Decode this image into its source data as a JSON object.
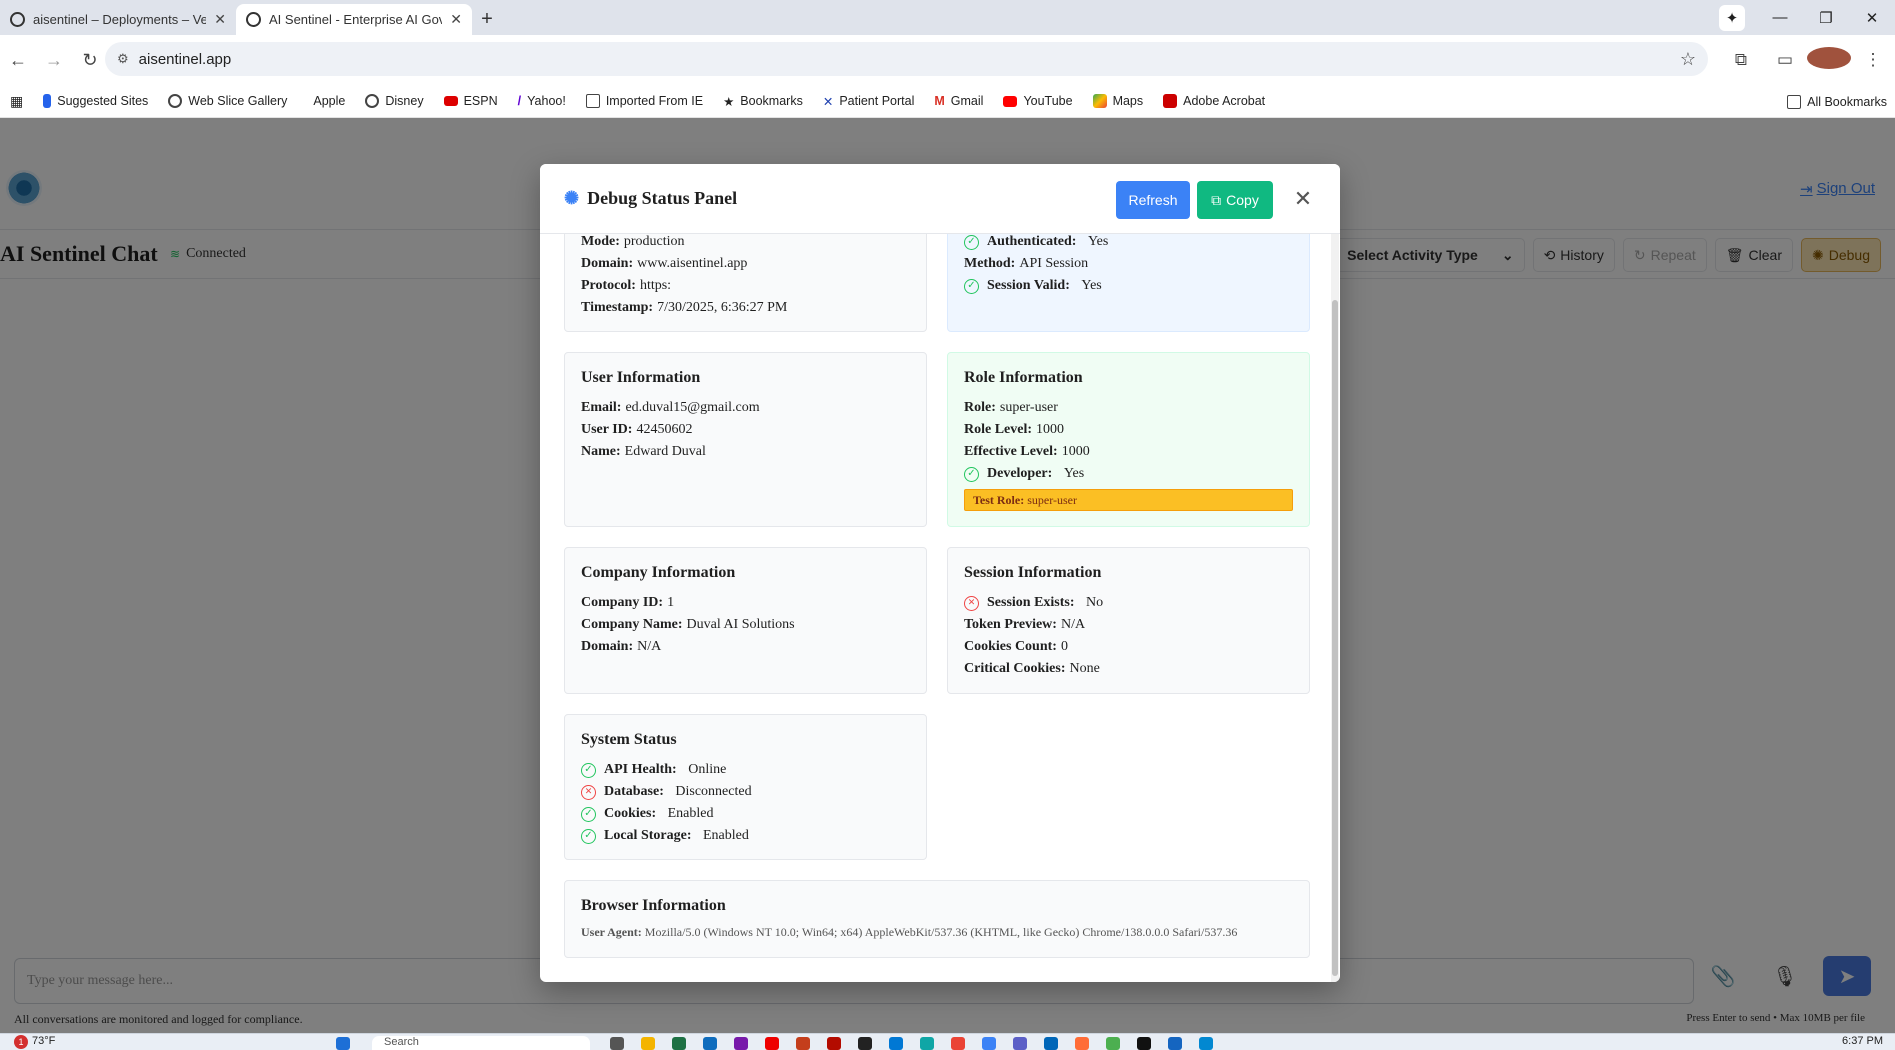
{
  "browser": {
    "tabs": [
      {
        "title": "aisentinel – Deployments – Vercel",
        "active": false
      },
      {
        "title": "AI Sentinel - Enterprise AI Governance",
        "active": true
      }
    ],
    "url": "aisentinel.app",
    "bookmarks": [
      "Suggested Sites",
      "Web Slice Gallery",
      "Apple",
      "Disney",
      "ESPN",
      "Yahoo!",
      "Imported From IE",
      "Bookmarks",
      "Patient Portal",
      "Gmail",
      "YouTube",
      "Maps",
      "Adobe Acrobat"
    ],
    "all_bookmarks": "All Bookmarks"
  },
  "app": {
    "sign_out": "Sign Out",
    "chat_title": "AI Sentinel Chat",
    "status": "Connected",
    "activity_select": "Select Activity Type",
    "buttons": {
      "history": "History",
      "repeat": "Repeat",
      "clear": "Clear",
      "debug": "Debug"
    },
    "input_placeholder": "Type your message here...",
    "footer_left": "All conversations are monitored and logged for compliance.",
    "footer_right": "Press Enter to send • Max 10MB per file"
  },
  "modal": {
    "title": "Debug Status Panel",
    "refresh": "Refresh",
    "copy": "Copy",
    "environment": {
      "mode_label": "Mode:",
      "mode": "production",
      "domain_label": "Domain:",
      "domain": "www.aisentinel.app",
      "protocol_label": "Protocol:",
      "protocol": "https:",
      "timestamp_label": "Timestamp:",
      "timestamp": "7/30/2025, 6:36:27 PM"
    },
    "auth": {
      "authenticated_label": "Authenticated:",
      "authenticated": "Yes",
      "method_label": "Method:",
      "method": "API Session",
      "session_valid_label": "Session Valid:",
      "session_valid": "Yes"
    },
    "user": {
      "heading": "User Information",
      "email_label": "Email:",
      "email": "ed.duval15@gmail.com",
      "user_id_label": "User ID:",
      "user_id": "42450602",
      "name_label": "Name:",
      "name": "Edward Duval"
    },
    "role": {
      "heading": "Role Information",
      "role_label": "Role:",
      "role": "super-user",
      "role_level_label": "Role Level:",
      "role_level": "1000",
      "effective_level_label": "Effective Level:",
      "effective_level": "1000",
      "developer_label": "Developer:",
      "developer": "Yes",
      "test_role_label": "Test Role:",
      "test_role": "super-user"
    },
    "company": {
      "heading": "Company Information",
      "company_id_label": "Company ID:",
      "company_id": "1",
      "company_name_label": "Company Name:",
      "company_name": "Duval AI Solutions",
      "domain_label": "Domain:",
      "domain": "N/A"
    },
    "session": {
      "heading": "Session Information",
      "session_exists_label": "Session Exists:",
      "session_exists": "No",
      "token_preview_label": "Token Preview:",
      "token_preview": "N/A",
      "cookies_count_label": "Cookies Count:",
      "cookies_count": "0",
      "critical_cookies_label": "Critical Cookies:",
      "critical_cookies": "None"
    },
    "system": {
      "heading": "System Status",
      "api_health_label": "API Health:",
      "api_health": "Online",
      "database_label": "Database:",
      "database": "Disconnected",
      "cookies_label": "Cookies:",
      "cookies": "Enabled",
      "local_storage_label": "Local Storage:",
      "local_storage": "Enabled"
    },
    "browser_info": {
      "heading": "Browser Information",
      "user_agent_label": "User Agent:",
      "user_agent": "Mozilla/5.0 (Windows NT 10.0; Win64; x64) AppleWebKit/537.36 (KHTML, like Gecko) Chrome/138.0.0.0 Safari/537.36"
    }
  },
  "taskbar": {
    "weather": "73°F",
    "notification_count": "1",
    "search": "Search",
    "time": "6:37 PM"
  }
}
